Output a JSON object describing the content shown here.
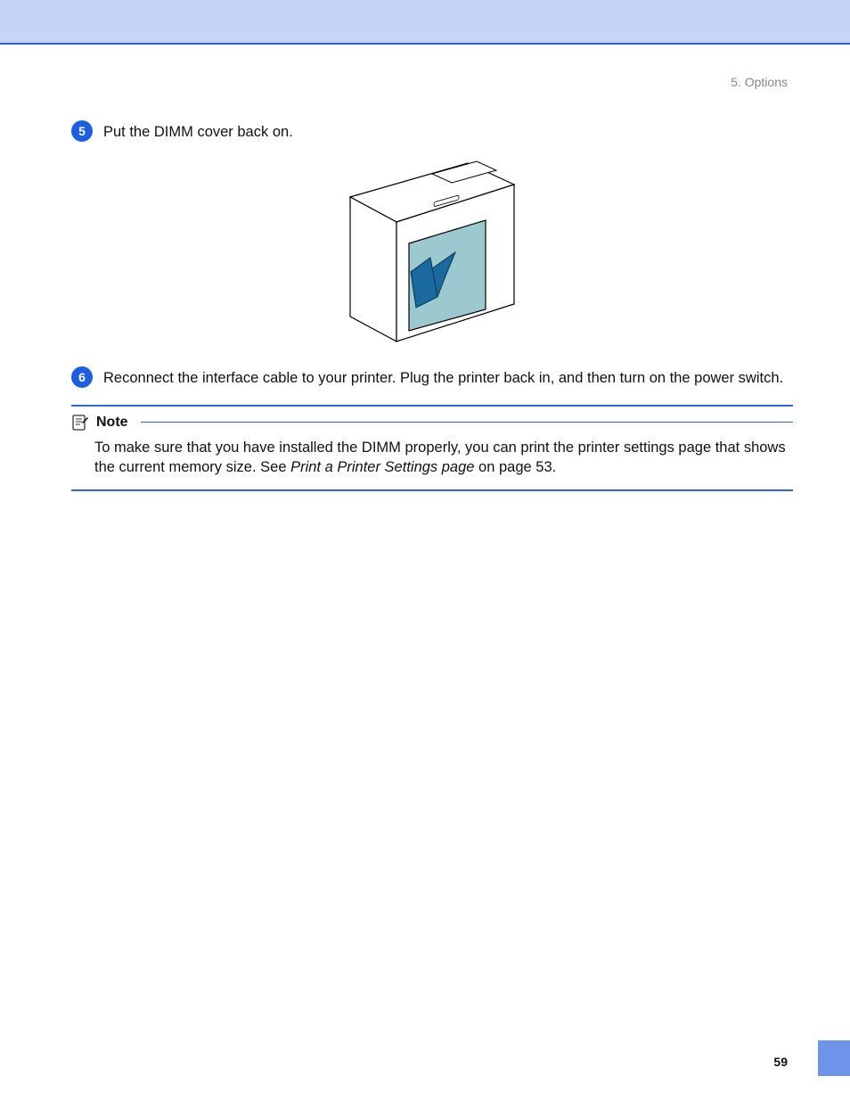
{
  "header": {
    "breadcrumb": "5. Options"
  },
  "steps": {
    "s5": {
      "num": "5",
      "text": "Put the DIMM cover back on."
    },
    "s6": {
      "num": "6",
      "text": "Reconnect the interface cable to your printer. Plug the printer back in, and then turn on the power switch."
    }
  },
  "note": {
    "label": "Note",
    "text_before": "To make sure that you have installed the DIMM properly, you can print the printer settings page that shows the current memory size. See ",
    "text_link": "Print a Printer Settings page",
    "text_after": " on page 53."
  },
  "page_number": "59"
}
